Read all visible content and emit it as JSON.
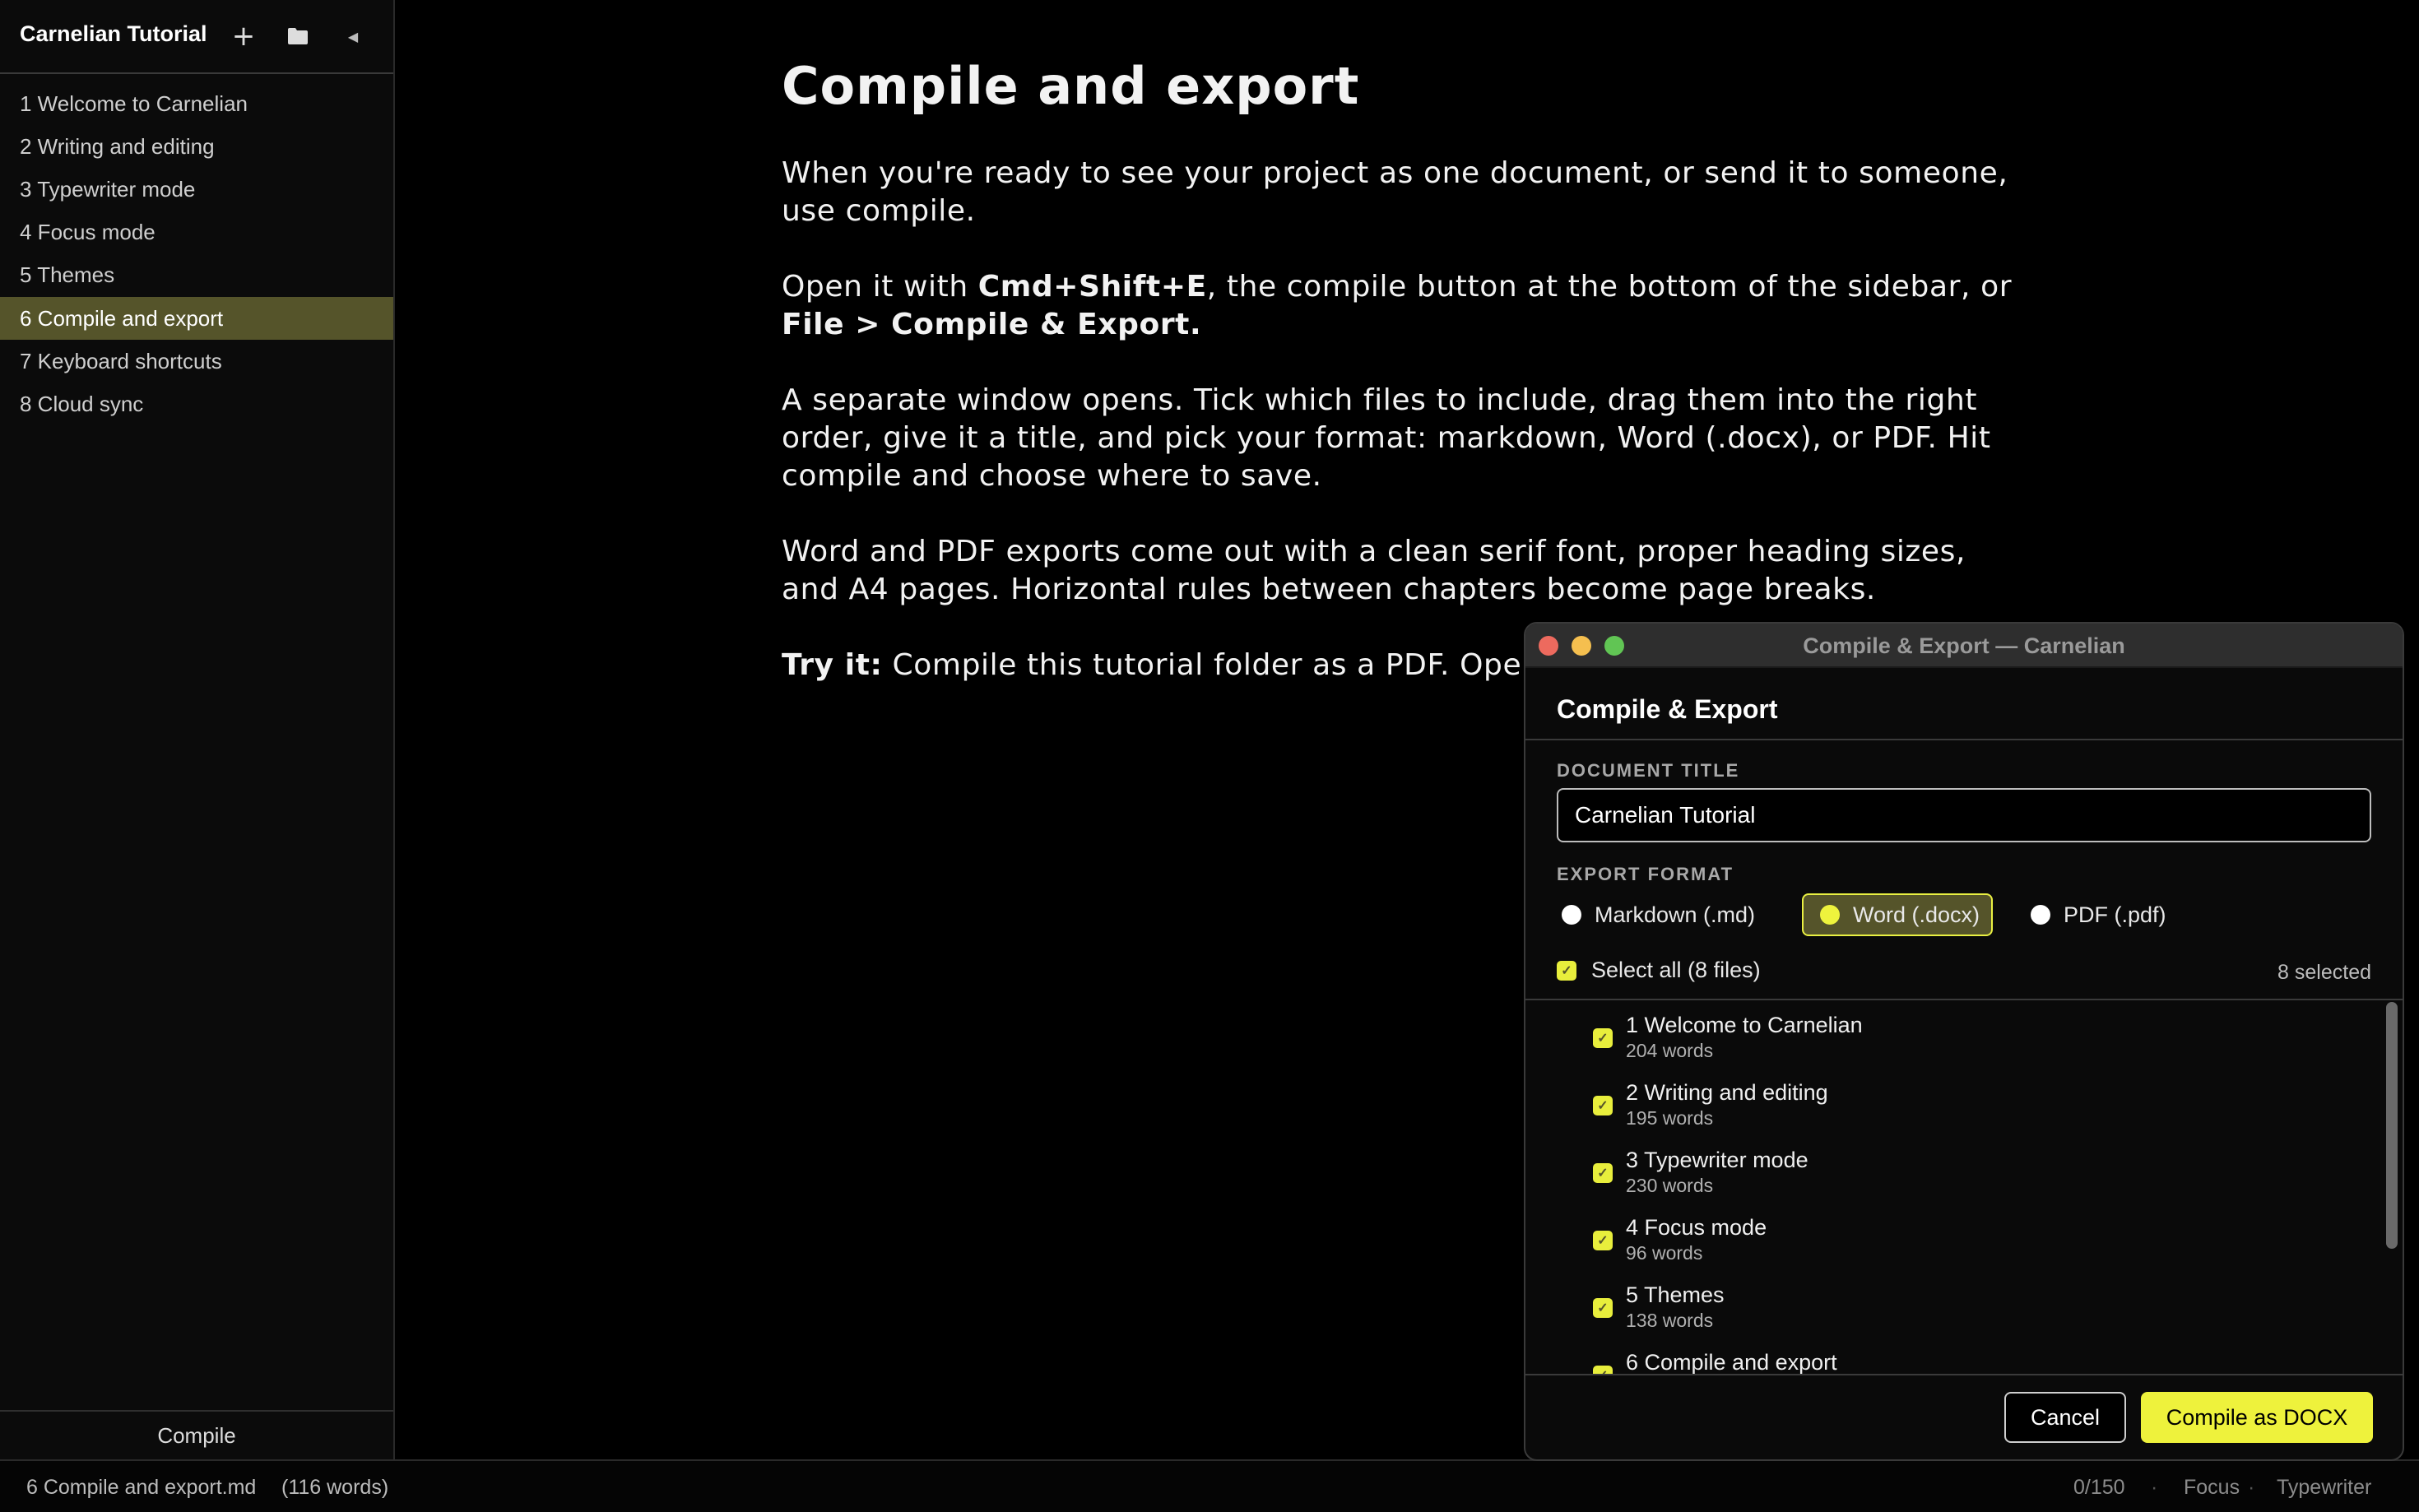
{
  "sidebar": {
    "project_title": "Carnelian Tutorial",
    "files": [
      {
        "label": "1 Welcome to Carnelian"
      },
      {
        "label": "2 Writing and editing"
      },
      {
        "label": "3 Typewriter mode"
      },
      {
        "label": "4 Focus mode"
      },
      {
        "label": "5 Themes"
      },
      {
        "label": "6 Compile and export",
        "active": true
      },
      {
        "label": "7 Keyboard shortcuts"
      },
      {
        "label": "8 Cloud sync"
      }
    ],
    "compile_label": "Compile"
  },
  "editor": {
    "heading": "Compile and export",
    "p1": "When you're ready to see your project as one document, or send it to someone, use compile.",
    "p2_a": "Open it with ",
    "p2_b": "Cmd+Shift+E",
    "p2_c": ", the compile button at the bottom of the sidebar, or ",
    "p2_d": "File > Compile & Export.",
    "p3": "A separate window opens. Tick which files to include, drag them into the right order, give it a title, and pick your format: markdown, Word (.docx), or PDF. Hit compile and choose where to save.",
    "p4": "Word and PDF exports come out with a clean serif font, proper heading sizes, and A4 pages. Horizontal rules between chapters become page breaks.",
    "p5_a": "Try it:",
    "p5_b": " Compile this tutorial folder as a PDF. Open"
  },
  "statusbar": {
    "file": "6 Compile and export.md",
    "words": "(116 words)",
    "progress": "0/150",
    "separator": "·",
    "focus": "Focus",
    "typewriter": "Typewriter"
  },
  "dialog": {
    "window_title": "Compile & Export — Carnelian",
    "heading": "Compile & Export",
    "title_label": "DOCUMENT TITLE",
    "title_value": "Carnelian Tutorial",
    "format_label": "EXPORT FORMAT",
    "formats": [
      {
        "label": "Markdown (.md)",
        "selected": false
      },
      {
        "label": "Word (.docx)",
        "selected": true
      },
      {
        "label": "PDF (.pdf)",
        "selected": false
      }
    ],
    "select_all": "Select all (8 files)",
    "selected_count": "8 selected",
    "checkmark": "✓",
    "files": [
      {
        "name": "1 Welcome to Carnelian",
        "words": "204 words"
      },
      {
        "name": "2 Writing and editing",
        "words": "195 words"
      },
      {
        "name": "3 Typewriter mode",
        "words": "230 words"
      },
      {
        "name": "4 Focus mode",
        "words": "96 words"
      },
      {
        "name": "5 Themes",
        "words": "138 words"
      },
      {
        "name": "6 Compile and export",
        "words": ""
      }
    ],
    "cancel": "Cancel",
    "compile": "Compile as DOCX"
  },
  "colors": {
    "accent": "#eef23c",
    "active_bg": "#55542a"
  }
}
